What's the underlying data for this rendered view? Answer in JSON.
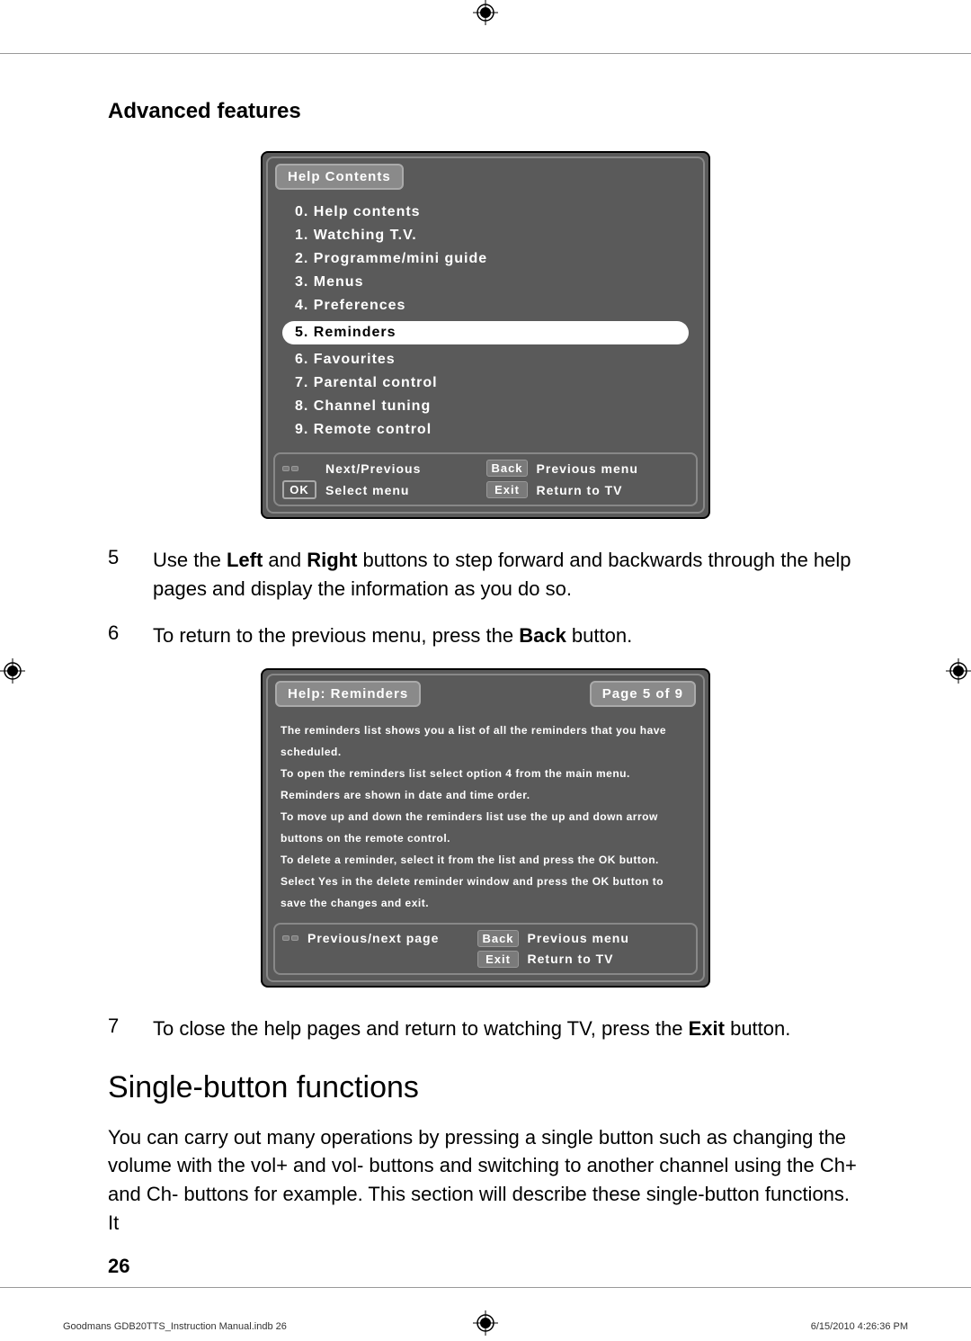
{
  "colorbars_left": [
    "#000000",
    "#000000",
    "#000000",
    "#404040",
    "#606060",
    "#808080",
    "#a0a0a0",
    "#b8b8b8",
    "#d0d0d0",
    "#e8e8e8",
    "#f4f4f4",
    "#ffffff"
  ],
  "colorbars_right": [
    "#ffffff",
    "#ffff00",
    "#00a0e0",
    "#e000a0",
    "#00a050",
    "#ff0000",
    "#0000c0",
    "#000000",
    "#ff90c0",
    "#40c0e0",
    "#808000",
    "#404040"
  ],
  "section_title": "Advanced features",
  "help_menu": {
    "title": "Help Contents",
    "items": [
      "0. Help contents",
      "1. Watching T.V.",
      "2. Programme/mini guide",
      "3. Menus",
      "4. Preferences",
      "5. Reminders",
      "6. Favourites",
      "7. Parental control",
      "8. Channel tuning",
      "9. Remote control"
    ],
    "selected_index": 5,
    "footer": {
      "updown_label": "Next/Previous",
      "back_key": "Back",
      "back_label": "Previous menu",
      "ok_key": "OK",
      "ok_label": "Select menu",
      "exit_key": "Exit",
      "exit_label": "Return to TV"
    }
  },
  "step5": {
    "num": "5",
    "text_pre": "Use the ",
    "bold1": "Left",
    "text_mid": " and ",
    "bold2": "Right",
    "text_post": " buttons to step forward and backwards through the help pages and display the information as you do so."
  },
  "step6": {
    "num": "6",
    "text_pre": "To return to the previous menu, press the ",
    "bold1": "Back",
    "text_post": " button."
  },
  "reminders_screen": {
    "title": "Help: Reminders",
    "page": "Page 5 of 9",
    "paragraphs": [
      "The reminders list shows you a list of all the reminders that you have scheduled.",
      "To open the reminders list select option 4 from the main menu.",
      "Reminders are shown in date and time order.",
      "To move up and down the reminders list use the up and down arrow buttons on the remote control.",
      "To delete a reminder, select it from the list and press the OK button.",
      "Select Yes in the delete reminder window and press the OK button to save the changes and exit."
    ],
    "footer": {
      "lr_label": "Previous/next page",
      "back_key": "Back",
      "back_label": "Previous menu",
      "exit_key": "Exit",
      "exit_label": "Return to TV"
    }
  },
  "step7": {
    "num": "7",
    "text_pre": "To close the help pages and return to watching TV, press the ",
    "bold1": "Exit",
    "text_post": " button."
  },
  "h2": "Single-button functions",
  "body_para": "You can carry out many operations by pressing a single button such as changing the volume with the vol+ and vol- buttons and switching to another channel using the Ch+ and Ch- buttons for example. This section will describe these single-button functions. It",
  "page_number": "26",
  "footer_left": "Goodmans GDB20TTS_Instruction Manual.indb   26",
  "footer_right": "6/15/2010   4:26:36 PM"
}
